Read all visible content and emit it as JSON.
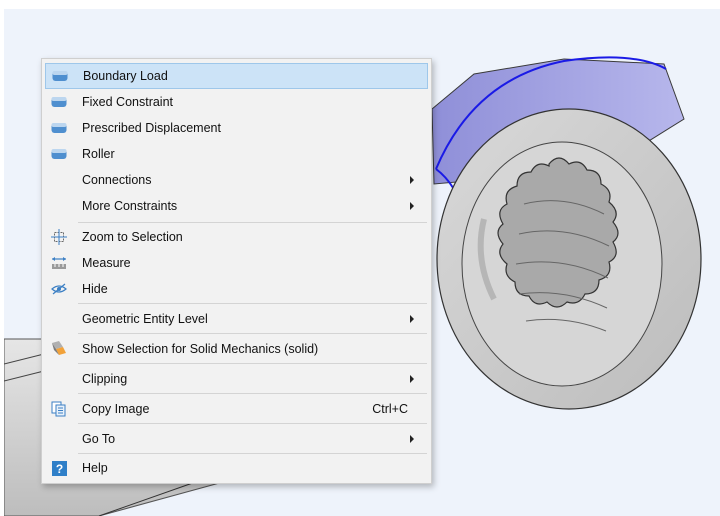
{
  "menu": {
    "items": [
      {
        "label": "Boundary Load",
        "icon": "boundary-load-icon"
      },
      {
        "label": "Fixed Constraint",
        "icon": "fixed-constraint-icon"
      },
      {
        "label": "Prescribed Displacement",
        "icon": "prescribed-displacement-icon"
      },
      {
        "label": "Roller",
        "icon": "roller-icon"
      },
      {
        "label": "Connections",
        "submenu": true
      },
      {
        "label": "More Constraints",
        "submenu": true
      },
      {
        "label": "Zoom to Selection",
        "icon": "zoom-to-selection-icon"
      },
      {
        "label": "Measure",
        "icon": "measure-icon"
      },
      {
        "label": "Hide",
        "icon": "hide-icon"
      },
      {
        "label": "Geometric Entity Level",
        "submenu": true
      },
      {
        "label": "Show Selection for Solid Mechanics (solid)",
        "icon": "show-selection-icon"
      },
      {
        "label": "Clipping",
        "submenu": true
      },
      {
        "label": "Copy Image",
        "icon": "copy-image-icon",
        "shortcut": "Ctrl+C"
      },
      {
        "label": "Go To",
        "submenu": true
      },
      {
        "label": "Help",
        "icon": "help-icon"
      }
    ],
    "highlighted_item": "Boundary Load"
  },
  "colors": {
    "selection_edge": "#1a1ae6",
    "highlight_bg": "#cce3f7",
    "viewport_bg": "#eef3fb"
  }
}
